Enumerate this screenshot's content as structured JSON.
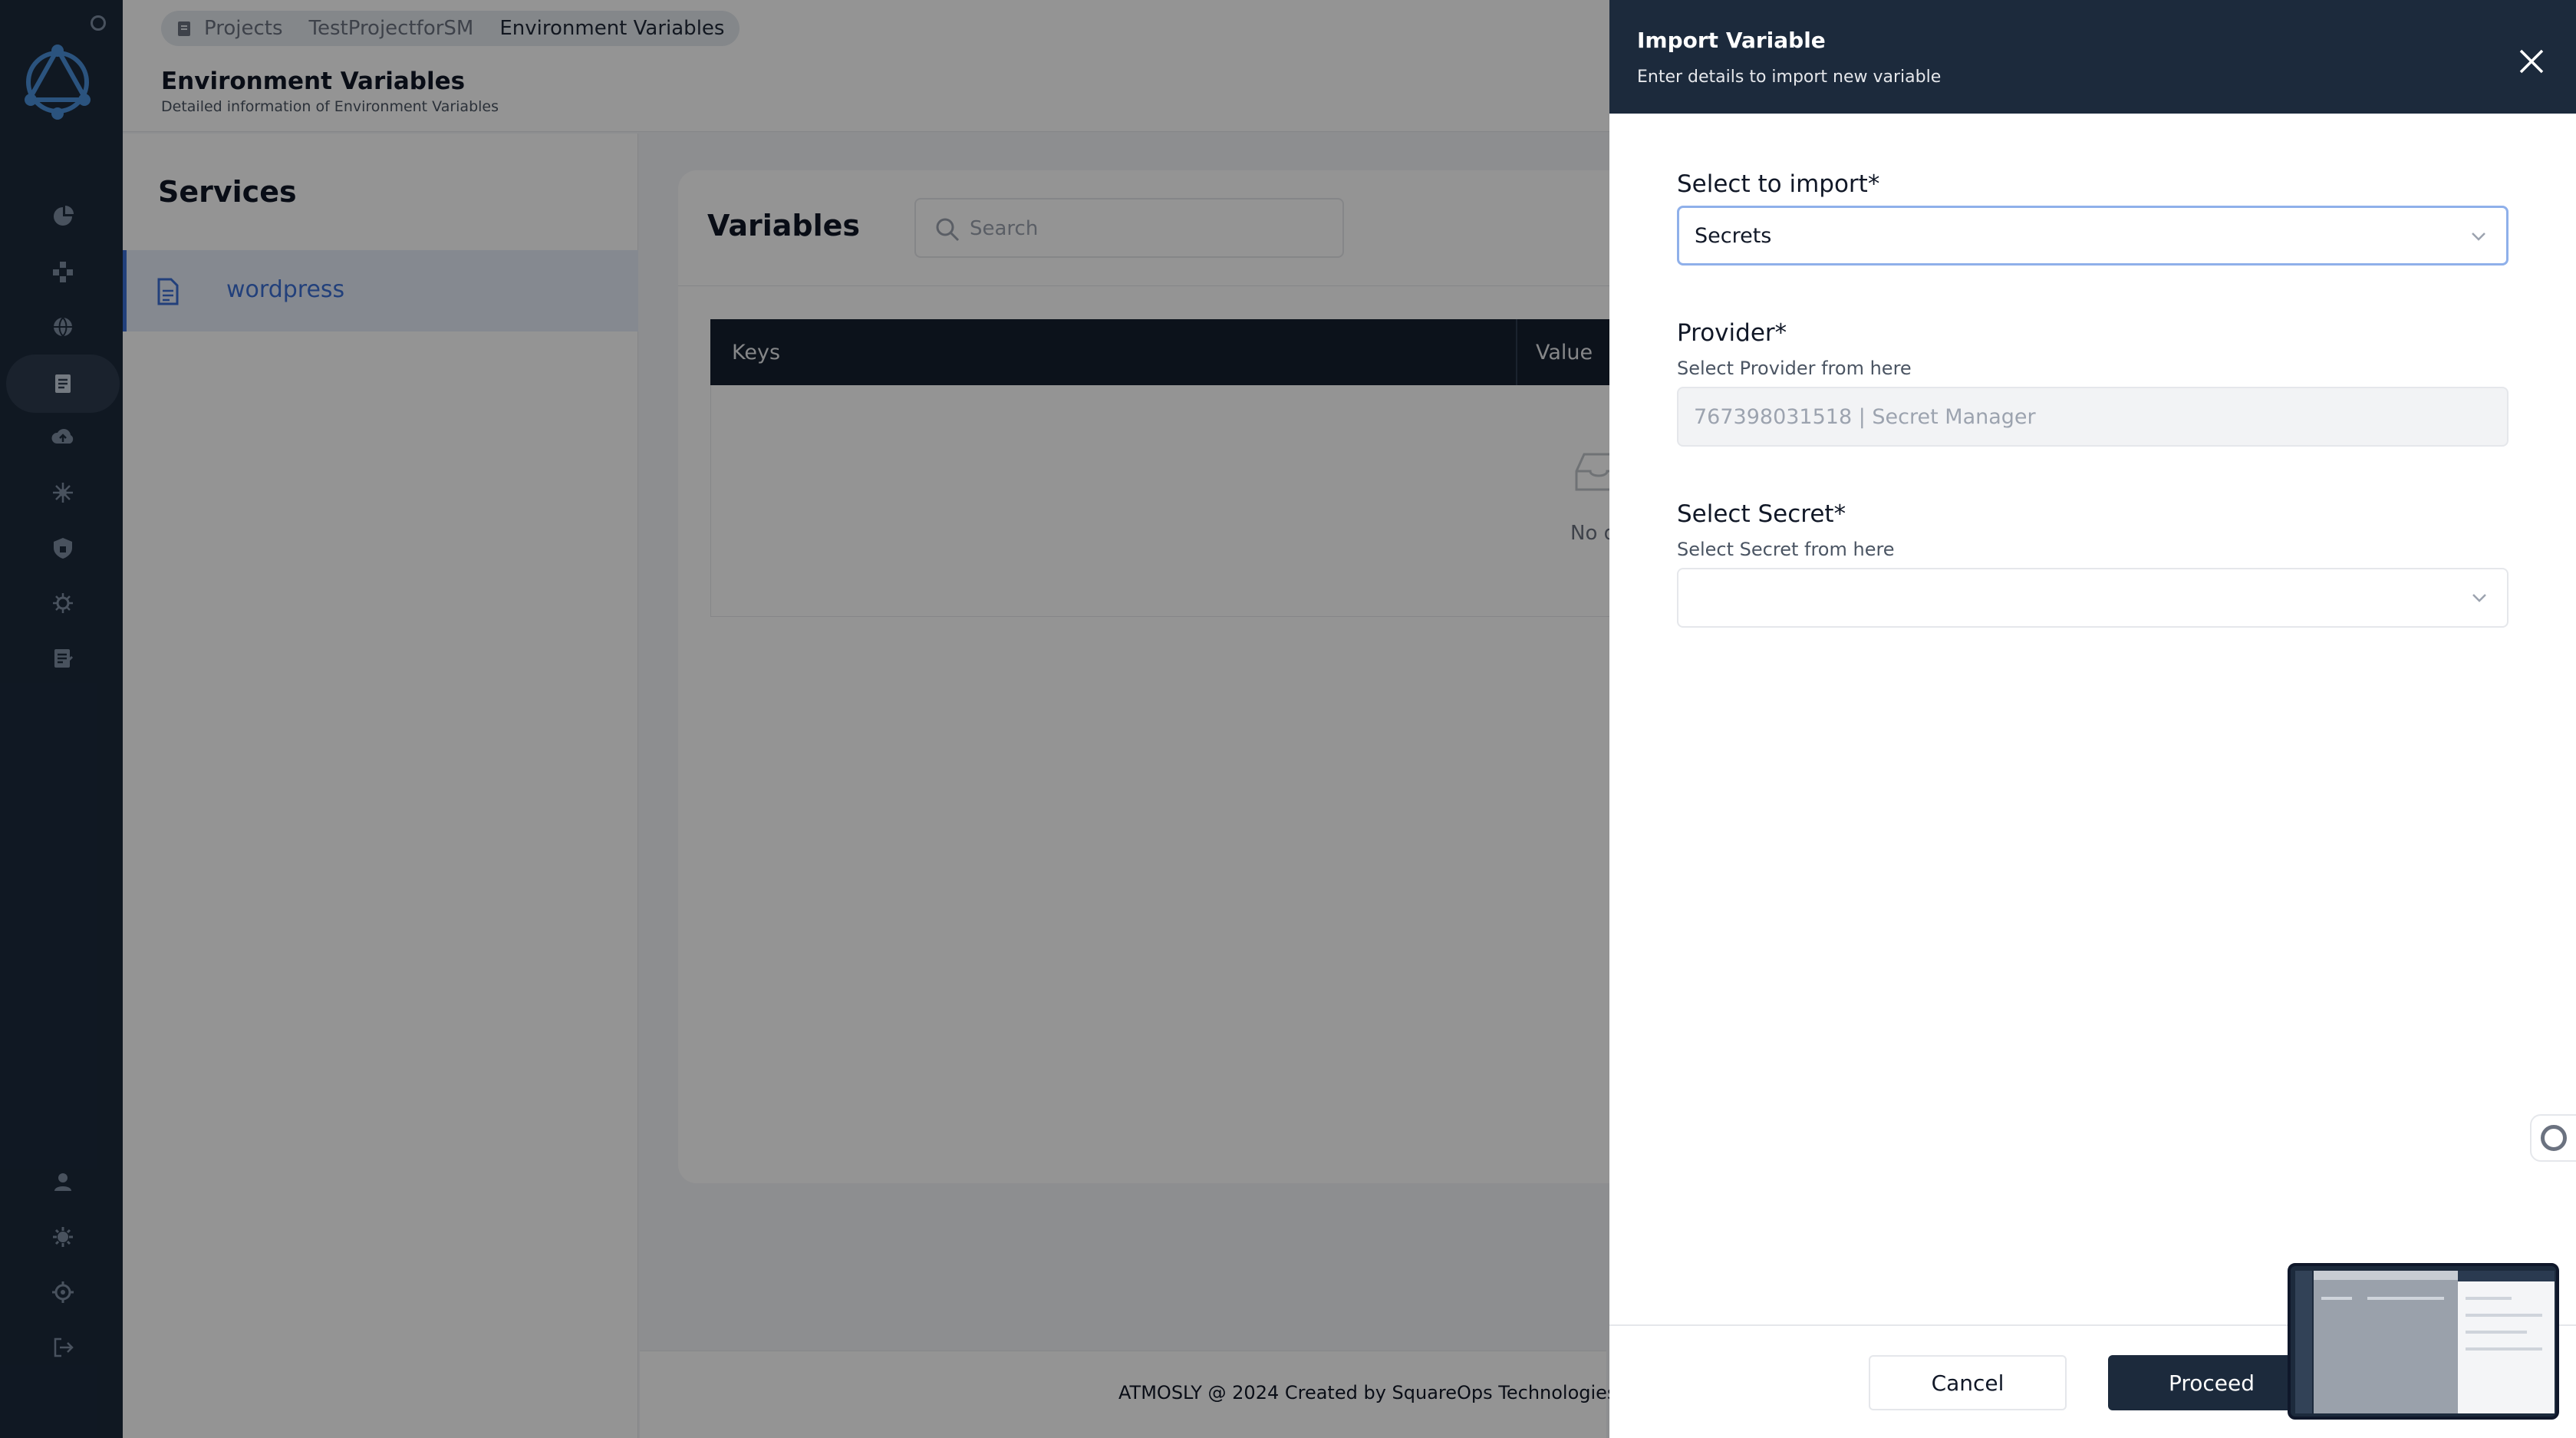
{
  "breadcrumb": {
    "items": [
      "Projects",
      "TestProjectforSM",
      "Environment Variables"
    ]
  },
  "page": {
    "title": "Environment Variables",
    "subtitle": "Detailed information of Environment Variables"
  },
  "services": {
    "title": "Services",
    "items": [
      {
        "label": "wordpress",
        "selected": true
      }
    ]
  },
  "variables": {
    "title": "Variables",
    "search_placeholder": "Search",
    "columns": [
      "Keys",
      "Value"
    ],
    "empty_text": "No d"
  },
  "footer": {
    "text": "ATMOSLY @ 2024 Created by SquareOps Technologies"
  },
  "drawer": {
    "title": "Import Variable",
    "subtitle": "Enter details to import new variable",
    "fields": {
      "import": {
        "label": "Select to import*",
        "value": "Secrets"
      },
      "provider": {
        "label": "Provider*",
        "help": "Select Provider from here",
        "value": "767398031518 | Secret Manager",
        "disabled": true
      },
      "secret": {
        "label": "Select Secret*",
        "help": "Select Secret from here",
        "value": ""
      }
    },
    "buttons": {
      "cancel": "Cancel",
      "proceed": "Proceed"
    }
  },
  "icons": {
    "rail": [
      "logo-icon",
      "dashboard-icon",
      "workflow-icon",
      "globe-icon",
      "environment-icon",
      "cloud-upload-icon",
      "integrations-icon",
      "security-icon",
      "settings-alt-icon",
      "notes-icon",
      "user-icon",
      "team-icon",
      "gear-icon",
      "logout-icon"
    ]
  },
  "colors": {
    "sidebar": "#1c2a3c",
    "accent": "#3b6fd4",
    "table_header": "#15202f",
    "primary_button": "#1c2a3c"
  }
}
